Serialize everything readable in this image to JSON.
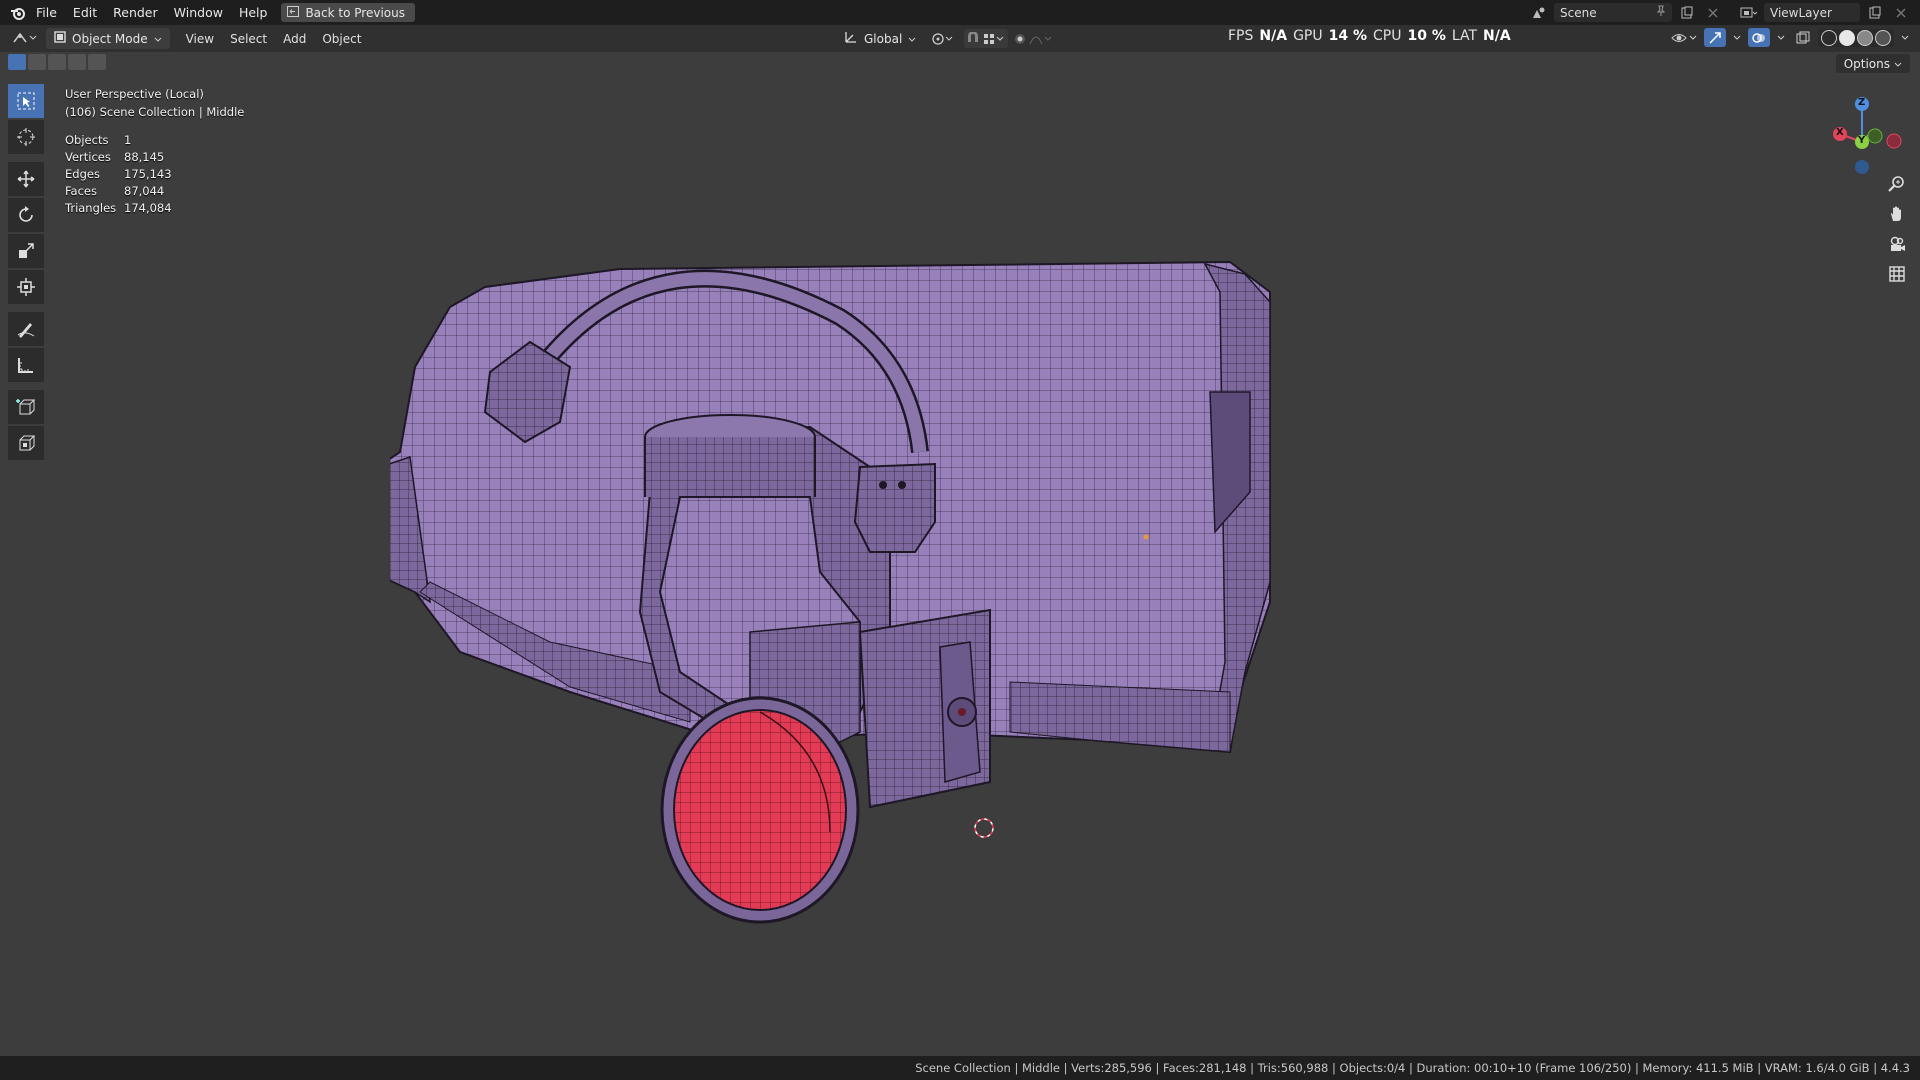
{
  "menu": {
    "items": [
      "File",
      "Edit",
      "Render",
      "Window",
      "Help"
    ],
    "back_label": "Back to Previous"
  },
  "top_right": {
    "scene_label": "Scene",
    "view_layer_label": "ViewLayer"
  },
  "header": {
    "mode_label": "Object Mode",
    "menus": [
      "View",
      "Select",
      "Add",
      "Object"
    ],
    "transform_orientation": "Global",
    "perf": {
      "fps_label": "FPS",
      "fps_value": "N/A",
      "gpu_label": "GPU",
      "gpu_value": "14 %",
      "cpu_label": "CPU",
      "cpu_value": "10 %",
      "lat_label": "LAT",
      "lat_value": "N/A"
    }
  },
  "viewport": {
    "options_label": "Options",
    "perspective": "User Perspective (Local)",
    "collection": "(106) Scene Collection | Middle",
    "stats": [
      {
        "label": "Objects",
        "value": "1"
      },
      {
        "label": "Vertices",
        "value": "88,145"
      },
      {
        "label": "Edges",
        "value": "175,143"
      },
      {
        "label": "Faces",
        "value": "87,044"
      },
      {
        "label": "Triangles",
        "value": "174,084"
      }
    ],
    "gizmo": {
      "x": "X",
      "y": "Y",
      "z": "Z"
    }
  },
  "colors": {
    "model_face": "#9a82bd",
    "model_wire": "#2a2035",
    "bore_red": "#e33a55",
    "accent_blue": "#4772b3"
  },
  "status_bar": {
    "text": "Scene Collection | Middle | Verts:285,596 | Faces:281,148 | Tris:560,988 | Objects:0/4 | Duration: 00:10+10 (Frame 106/250) | Memory: 411.5 MiB | VRAM: 1.6/4.0 GiB | 4.4.3"
  }
}
